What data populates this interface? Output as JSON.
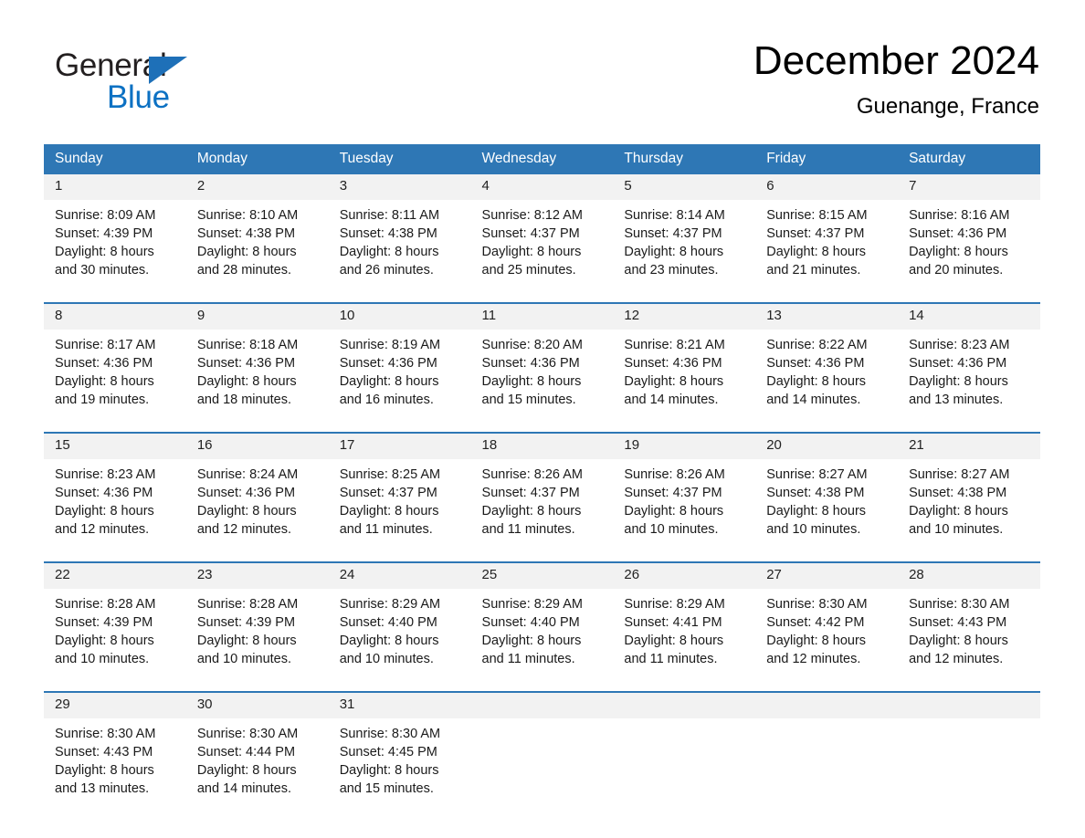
{
  "brand": {
    "name_part1": "General",
    "name_part2": "Blue",
    "triangle_color": "#1e70b8",
    "blue_color": "#0c71c3"
  },
  "header": {
    "month_title": "December 2024",
    "location": "Guenange, France"
  },
  "theme": {
    "header_blue": "#2e77b5",
    "daynum_band": "#f2f2f2"
  },
  "weekday_headers": [
    "Sunday",
    "Monday",
    "Tuesday",
    "Wednesday",
    "Thursday",
    "Friday",
    "Saturday"
  ],
  "weeks": [
    {
      "daynums": [
        "1",
        "2",
        "3",
        "4",
        "5",
        "6",
        "7"
      ],
      "cells": [
        {
          "sunrise": "Sunrise: 8:09 AM",
          "sunset": "Sunset: 4:39 PM",
          "daylight1": "Daylight: 8 hours",
          "daylight2": "and 30 minutes."
        },
        {
          "sunrise": "Sunrise: 8:10 AM",
          "sunset": "Sunset: 4:38 PM",
          "daylight1": "Daylight: 8 hours",
          "daylight2": "and 28 minutes."
        },
        {
          "sunrise": "Sunrise: 8:11 AM",
          "sunset": "Sunset: 4:38 PM",
          "daylight1": "Daylight: 8 hours",
          "daylight2": "and 26 minutes."
        },
        {
          "sunrise": "Sunrise: 8:12 AM",
          "sunset": "Sunset: 4:37 PM",
          "daylight1": "Daylight: 8 hours",
          "daylight2": "and 25 minutes."
        },
        {
          "sunrise": "Sunrise: 8:14 AM",
          "sunset": "Sunset: 4:37 PM",
          "daylight1": "Daylight: 8 hours",
          "daylight2": "and 23 minutes."
        },
        {
          "sunrise": "Sunrise: 8:15 AM",
          "sunset": "Sunset: 4:37 PM",
          "daylight1": "Daylight: 8 hours",
          "daylight2": "and 21 minutes."
        },
        {
          "sunrise": "Sunrise: 8:16 AM",
          "sunset": "Sunset: 4:36 PM",
          "daylight1": "Daylight: 8 hours",
          "daylight2": "and 20 minutes."
        }
      ]
    },
    {
      "daynums": [
        "8",
        "9",
        "10",
        "11",
        "12",
        "13",
        "14"
      ],
      "cells": [
        {
          "sunrise": "Sunrise: 8:17 AM",
          "sunset": "Sunset: 4:36 PM",
          "daylight1": "Daylight: 8 hours",
          "daylight2": "and 19 minutes."
        },
        {
          "sunrise": "Sunrise: 8:18 AM",
          "sunset": "Sunset: 4:36 PM",
          "daylight1": "Daylight: 8 hours",
          "daylight2": "and 18 minutes."
        },
        {
          "sunrise": "Sunrise: 8:19 AM",
          "sunset": "Sunset: 4:36 PM",
          "daylight1": "Daylight: 8 hours",
          "daylight2": "and 16 minutes."
        },
        {
          "sunrise": "Sunrise: 8:20 AM",
          "sunset": "Sunset: 4:36 PM",
          "daylight1": "Daylight: 8 hours",
          "daylight2": "and 15 minutes."
        },
        {
          "sunrise": "Sunrise: 8:21 AM",
          "sunset": "Sunset: 4:36 PM",
          "daylight1": "Daylight: 8 hours",
          "daylight2": "and 14 minutes."
        },
        {
          "sunrise": "Sunrise: 8:22 AM",
          "sunset": "Sunset: 4:36 PM",
          "daylight1": "Daylight: 8 hours",
          "daylight2": "and 14 minutes."
        },
        {
          "sunrise": "Sunrise: 8:23 AM",
          "sunset": "Sunset: 4:36 PM",
          "daylight1": "Daylight: 8 hours",
          "daylight2": "and 13 minutes."
        }
      ]
    },
    {
      "daynums": [
        "15",
        "16",
        "17",
        "18",
        "19",
        "20",
        "21"
      ],
      "cells": [
        {
          "sunrise": "Sunrise: 8:23 AM",
          "sunset": "Sunset: 4:36 PM",
          "daylight1": "Daylight: 8 hours",
          "daylight2": "and 12 minutes."
        },
        {
          "sunrise": "Sunrise: 8:24 AM",
          "sunset": "Sunset: 4:36 PM",
          "daylight1": "Daylight: 8 hours",
          "daylight2": "and 12 minutes."
        },
        {
          "sunrise": "Sunrise: 8:25 AM",
          "sunset": "Sunset: 4:37 PM",
          "daylight1": "Daylight: 8 hours",
          "daylight2": "and 11 minutes."
        },
        {
          "sunrise": "Sunrise: 8:26 AM",
          "sunset": "Sunset: 4:37 PM",
          "daylight1": "Daylight: 8 hours",
          "daylight2": "and 11 minutes."
        },
        {
          "sunrise": "Sunrise: 8:26 AM",
          "sunset": "Sunset: 4:37 PM",
          "daylight1": "Daylight: 8 hours",
          "daylight2": "and 10 minutes."
        },
        {
          "sunrise": "Sunrise: 8:27 AM",
          "sunset": "Sunset: 4:38 PM",
          "daylight1": "Daylight: 8 hours",
          "daylight2": "and 10 minutes."
        },
        {
          "sunrise": "Sunrise: 8:27 AM",
          "sunset": "Sunset: 4:38 PM",
          "daylight1": "Daylight: 8 hours",
          "daylight2": "and 10 minutes."
        }
      ]
    },
    {
      "daynums": [
        "22",
        "23",
        "24",
        "25",
        "26",
        "27",
        "28"
      ],
      "cells": [
        {
          "sunrise": "Sunrise: 8:28 AM",
          "sunset": "Sunset: 4:39 PM",
          "daylight1": "Daylight: 8 hours",
          "daylight2": "and 10 minutes."
        },
        {
          "sunrise": "Sunrise: 8:28 AM",
          "sunset": "Sunset: 4:39 PM",
          "daylight1": "Daylight: 8 hours",
          "daylight2": "and 10 minutes."
        },
        {
          "sunrise": "Sunrise: 8:29 AM",
          "sunset": "Sunset: 4:40 PM",
          "daylight1": "Daylight: 8 hours",
          "daylight2": "and 10 minutes."
        },
        {
          "sunrise": "Sunrise: 8:29 AM",
          "sunset": "Sunset: 4:40 PM",
          "daylight1": "Daylight: 8 hours",
          "daylight2": "and 11 minutes."
        },
        {
          "sunrise": "Sunrise: 8:29 AM",
          "sunset": "Sunset: 4:41 PM",
          "daylight1": "Daylight: 8 hours",
          "daylight2": "and 11 minutes."
        },
        {
          "sunrise": "Sunrise: 8:30 AM",
          "sunset": "Sunset: 4:42 PM",
          "daylight1": "Daylight: 8 hours",
          "daylight2": "and 12 minutes."
        },
        {
          "sunrise": "Sunrise: 8:30 AM",
          "sunset": "Sunset: 4:43 PM",
          "daylight1": "Daylight: 8 hours",
          "daylight2": "and 12 minutes."
        }
      ]
    },
    {
      "daynums": [
        "29",
        "30",
        "31",
        "",
        "",
        "",
        ""
      ],
      "cells": [
        {
          "sunrise": "Sunrise: 8:30 AM",
          "sunset": "Sunset: 4:43 PM",
          "daylight1": "Daylight: 8 hours",
          "daylight2": "and 13 minutes."
        },
        {
          "sunrise": "Sunrise: 8:30 AM",
          "sunset": "Sunset: 4:44 PM",
          "daylight1": "Daylight: 8 hours",
          "daylight2": "and 14 minutes."
        },
        {
          "sunrise": "Sunrise: 8:30 AM",
          "sunset": "Sunset: 4:45 PM",
          "daylight1": "Daylight: 8 hours",
          "daylight2": "and 15 minutes."
        },
        {
          "sunrise": "",
          "sunset": "",
          "daylight1": "",
          "daylight2": ""
        },
        {
          "sunrise": "",
          "sunset": "",
          "daylight1": "",
          "daylight2": ""
        },
        {
          "sunrise": "",
          "sunset": "",
          "daylight1": "",
          "daylight2": ""
        },
        {
          "sunrise": "",
          "sunset": "",
          "daylight1": "",
          "daylight2": ""
        }
      ]
    }
  ]
}
